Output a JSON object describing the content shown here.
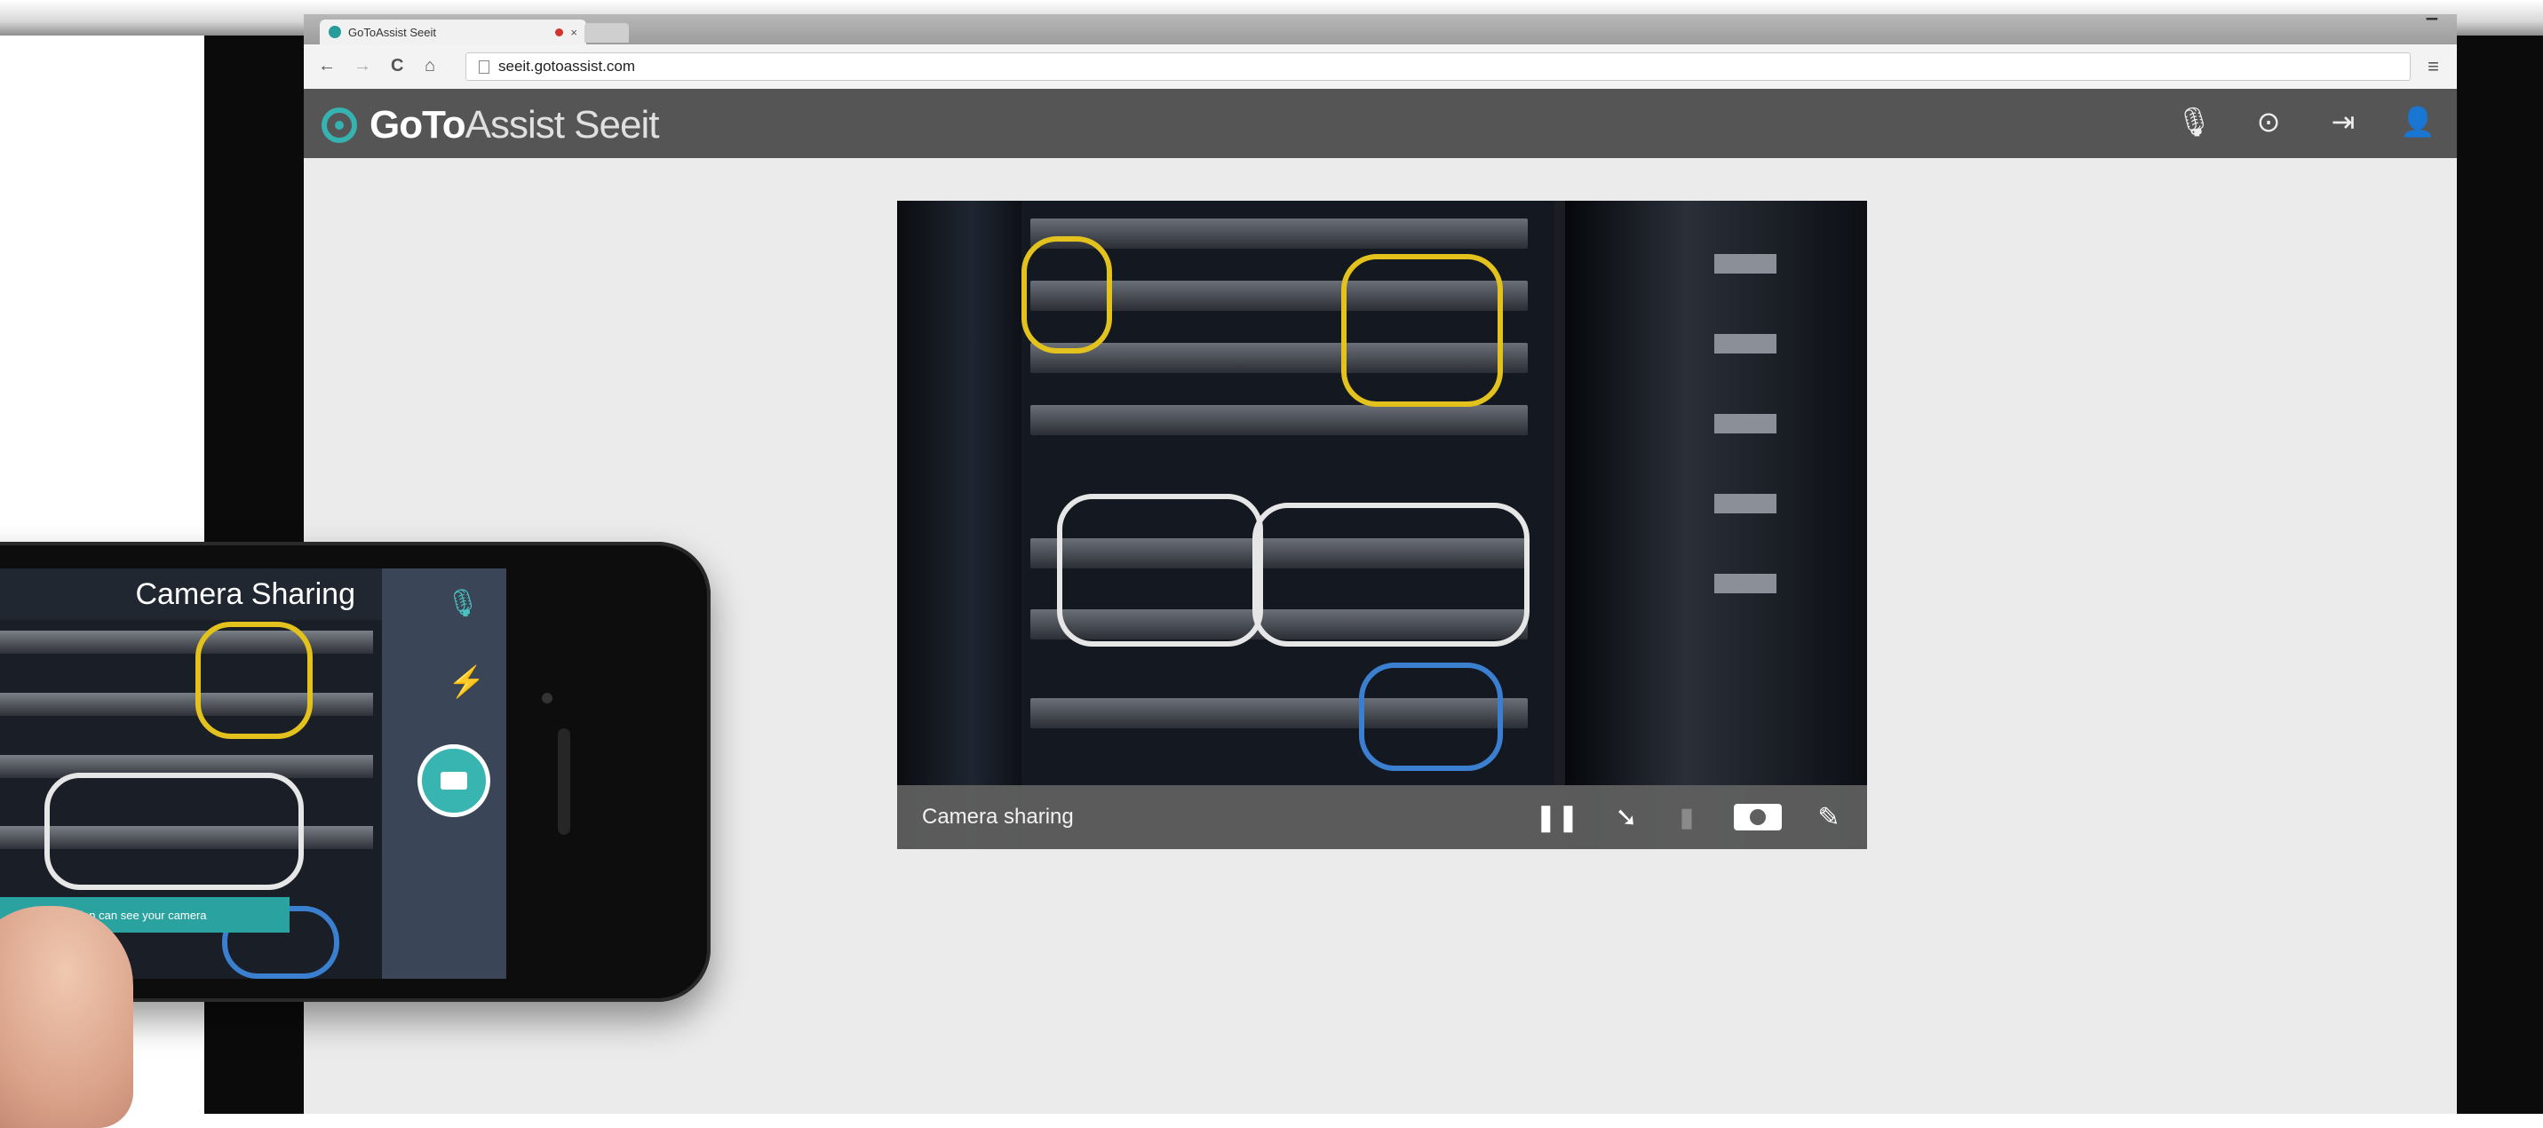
{
  "browser": {
    "tab_title": "GoToAssist Seeit",
    "tab_close": "×",
    "url": "seeit.gotoassist.com",
    "window_controls": "▔",
    "menu_icon": "≡",
    "nav": {
      "back": "←",
      "forward": "→",
      "reload": "C",
      "home": "⌂"
    }
  },
  "header": {
    "logo_bold": "GoTo",
    "logo_light": "Assist Seeit",
    "icons": [
      "microphone-icon",
      "record-icon",
      "sign-out-icon",
      "user-icon"
    ],
    "icon_glyphs": {
      "mic": "🎙",
      "record": "⊙",
      "sign_out": "⇥",
      "user": "👤"
    }
  },
  "video": {
    "label": "Camera sharing",
    "controls": {
      "pause": "❚❚",
      "pointer": "➘",
      "mic": "▮",
      "annotate": "✎"
    }
  },
  "phone": {
    "title": "Camera Sharing",
    "mic": "🎙",
    "flash": "⚡",
    "toast": "Technician can see your camera",
    "check": "✓"
  },
  "colors": {
    "accent": "#36b3b0",
    "header_bg": "#555555",
    "content_bg": "#ebebeb",
    "video_bar": "#5f5f5f"
  }
}
